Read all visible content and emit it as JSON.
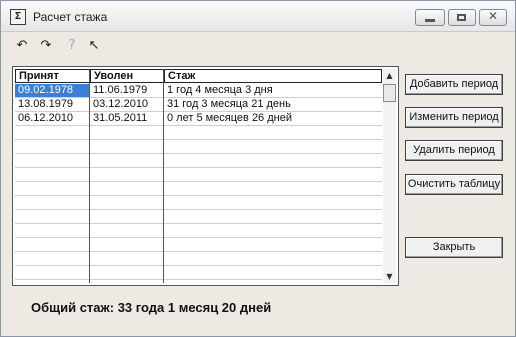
{
  "window": {
    "title": "Расчет стажа"
  },
  "titlebar_buttons": {
    "minimize": "—",
    "maximize": "□",
    "close": "✕"
  },
  "toolbar": {
    "tools": [
      {
        "icon": "undo-arrow-icon",
        "glyph": "↶",
        "enabled": true
      },
      {
        "icon": "redo-arrow-icon",
        "glyph": "↷",
        "enabled": true
      },
      {
        "icon": "help-icon",
        "glyph": "?",
        "enabled": false
      },
      {
        "icon": "whats-this-cursor-icon",
        "glyph": "↖",
        "enabled": true
      }
    ]
  },
  "table": {
    "columns": [
      "Принят",
      "Уволен",
      "Стаж"
    ],
    "rows": [
      {
        "hired": "09.02.1978",
        "fired": "11.06.1979",
        "tenure": "1 год 4 месяца 3 дня",
        "selected": true
      },
      {
        "hired": "13.08.1979",
        "fired": "03.12.2010",
        "tenure": "31 год 3 месяца 21 день",
        "selected": false
      },
      {
        "hired": "06.12.2010",
        "fired": "31.05.2011",
        "tenure": "0 лет 5 месяцев 26 дней",
        "selected": false
      }
    ]
  },
  "buttons": {
    "add": "Добавить период",
    "edit": "Изменить период",
    "delete": "Удалить период",
    "clear": "Очистить таблицу",
    "close": "Закрыть"
  },
  "summary": "Общий стаж: 33 года 1 месяц 20 дней",
  "colors": {
    "selection": "#3b7fd8"
  }
}
